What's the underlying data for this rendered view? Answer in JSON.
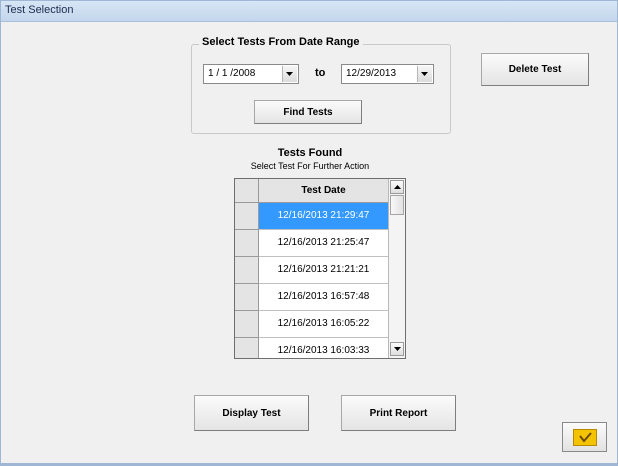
{
  "window": {
    "title": "Test Selection"
  },
  "date_range": {
    "legend": "Select Tests From Date Range",
    "from_value": "1 / 1 /2008",
    "to_label": "to",
    "to_value": "12/29/2013",
    "find_button": "Find Tests"
  },
  "actions": {
    "delete_button": "Delete Test",
    "display_button": "Display Test",
    "print_button": "Print Report"
  },
  "results": {
    "title": "Tests Found",
    "subtitle": "Select Test For Further Action",
    "column_header": "Test Date",
    "rows": [
      "12/16/2013 21:29:47",
      "12/16/2013 21:25:47",
      "12/16/2013 21:21:21",
      "12/16/2013 16:57:48",
      "12/16/2013 16:05:22",
      "12/16/2013 16:03:33"
    ],
    "selected_index": 0
  },
  "colors": {
    "selection": "#3399ff",
    "window_background": "#f0f0f0",
    "title_bar": "#c8daf0",
    "ok_icon": "#f3c200"
  },
  "icons": {
    "combo_dropdown": "chevron-down-icon",
    "scroll_up": "arrow-up-icon",
    "scroll_down": "arrow-down-icon",
    "ok": "yellow-check-icon"
  }
}
